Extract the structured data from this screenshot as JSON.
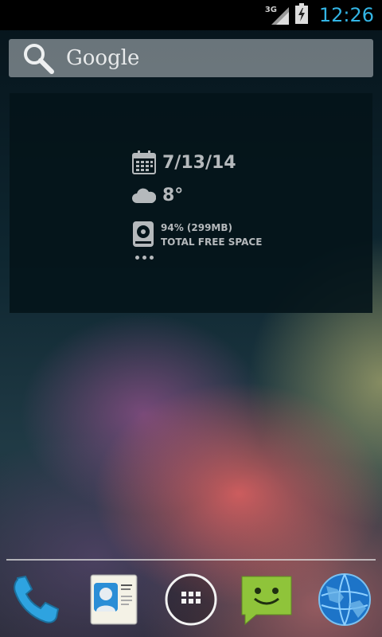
{
  "status_bar": {
    "network_type": "3G",
    "clock": "12:26",
    "icons": [
      "signal-icon",
      "battery-charging-icon"
    ]
  },
  "search": {
    "label": "Google",
    "icon": "search-icon"
  },
  "widget": {
    "date": "7/13/14",
    "temperature": "8°",
    "storage_line1": "94% (299MB)",
    "storage_line2": "TOTAL FREE SPACE",
    "icons": [
      "calendar-icon",
      "cloud-icon",
      "hard-drive-icon",
      "more-icon"
    ]
  },
  "dock": {
    "apps": [
      "phone-icon",
      "contacts-icon",
      "app-drawer-icon",
      "messaging-icon",
      "browser-icon"
    ]
  },
  "colors": {
    "clock": "#33b5e5",
    "widget_text": "#b5b9bc"
  }
}
